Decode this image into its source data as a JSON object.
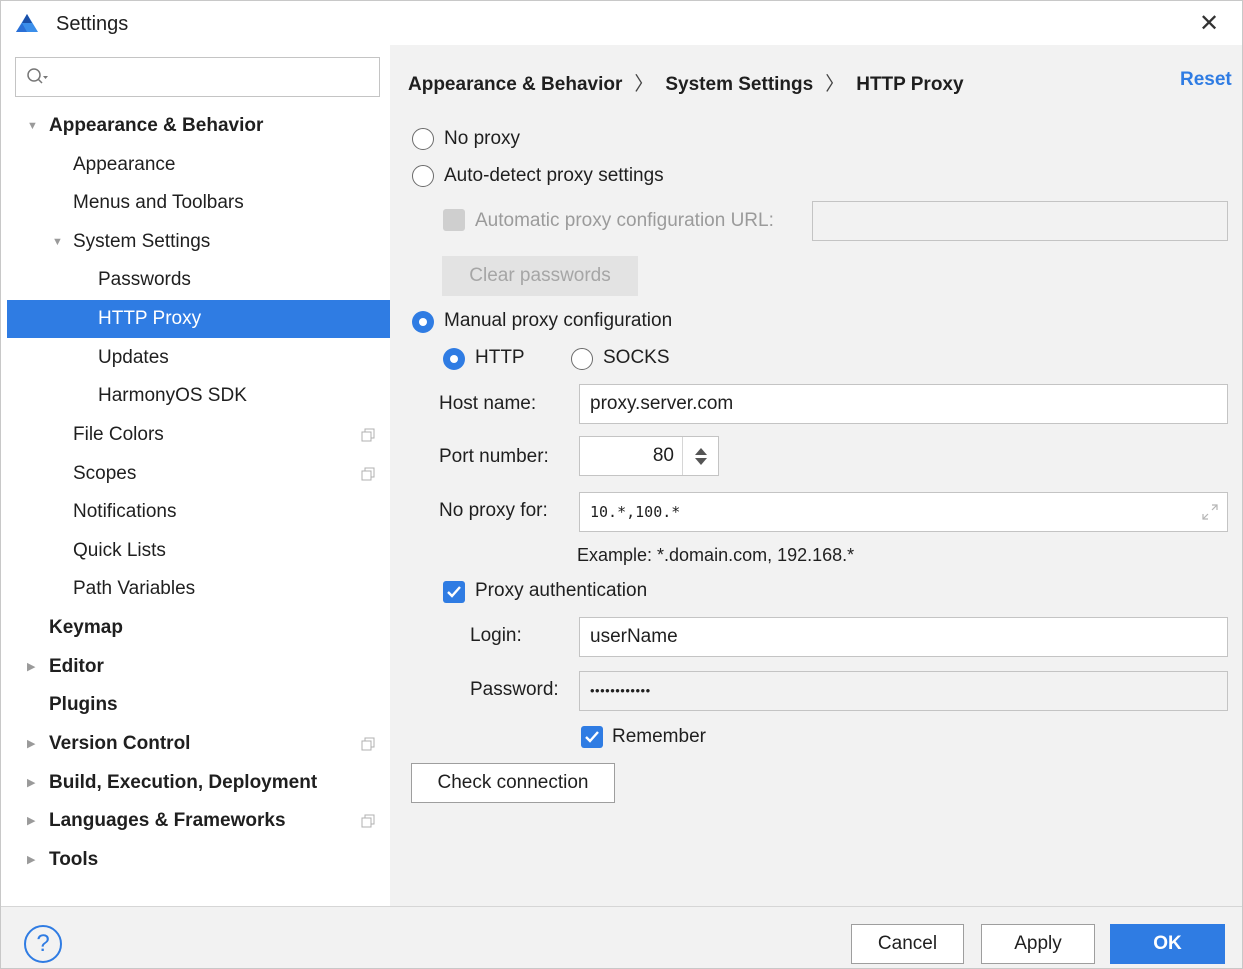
{
  "window": {
    "title": "Settings",
    "close_glyph": "✕"
  },
  "search": {
    "placeholder": ""
  },
  "sidebar": {
    "items": [
      {
        "label": "Appearance & Behavior",
        "arrow": "▼"
      },
      {
        "label": "Appearance"
      },
      {
        "label": "Menus and Toolbars"
      },
      {
        "label": "System Settings",
        "arrow": "▼"
      },
      {
        "label": "Passwords"
      },
      {
        "label": "HTTP Proxy"
      },
      {
        "label": "Updates"
      },
      {
        "label": "HarmonyOS SDK"
      },
      {
        "label": "File Colors"
      },
      {
        "label": "Scopes"
      },
      {
        "label": "Notifications"
      },
      {
        "label": "Quick Lists"
      },
      {
        "label": "Path Variables"
      },
      {
        "label": "Keymap"
      },
      {
        "label": "Editor",
        "arrow": "▶"
      },
      {
        "label": "Plugins"
      },
      {
        "label": "Version Control",
        "arrow": "▶"
      },
      {
        "label": "Build, Execution, Deployment",
        "arrow": "▶"
      },
      {
        "label": "Languages & Frameworks",
        "arrow": "▶"
      },
      {
        "label": "Tools",
        "arrow": "▶"
      }
    ]
  },
  "breadcrumb": {
    "parts": [
      "Appearance & Behavior",
      "System Settings",
      "HTTP Proxy"
    ],
    "sep": "〉"
  },
  "reset_label": "Reset",
  "proxy": {
    "no_proxy_label": "No proxy",
    "auto_detect_label": "Auto-detect proxy settings",
    "auto_url_label": "Automatic proxy configuration URL:",
    "auto_url_value": "",
    "clear_passwords_label": "Clear passwords",
    "manual_label": "Manual proxy configuration",
    "http_label": "HTTP",
    "socks_label": "SOCKS",
    "host_label": "Host name:",
    "host_value": "proxy.server.com",
    "port_label": "Port number:",
    "port_value": "80",
    "no_proxy_for_label": "No proxy for:",
    "no_proxy_for_value": "10.*,100.*",
    "example_text": "Example: *.domain.com, 192.168.*",
    "auth_label": "Proxy authentication",
    "login_label": "Login:",
    "login_value": "userName",
    "password_label": "Password:",
    "password_value": "••••••••••••",
    "remember_label": "Remember",
    "check_connection_label": "Check connection"
  },
  "footer": {
    "help_glyph": "?",
    "cancel_label": "Cancel",
    "apply_label": "Apply",
    "ok_label": "OK"
  },
  "colors": {
    "accent": "#2f7ce3",
    "panel": "#f2f2f2"
  }
}
